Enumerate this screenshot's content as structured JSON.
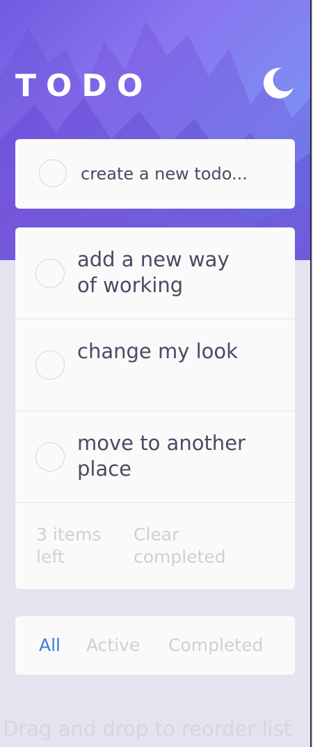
{
  "header": {
    "title": "TODO",
    "theme_toggle_icon": "moon-icon"
  },
  "new_todo": {
    "placeholder": "create a new todo..."
  },
  "todos": [
    {
      "text": "add a new way of working",
      "completed": false
    },
    {
      "text": "change my look",
      "completed": false
    },
    {
      "text": "move to another place",
      "completed": false
    }
  ],
  "footer": {
    "items_left": "3 items left",
    "clear_label": "Clear completed"
  },
  "filters": {
    "all": "All",
    "active": "Active",
    "completed": "Completed",
    "selected": "All"
  },
  "hint": "Drag and drop to reorder list",
  "colors": {
    "accent": "#3a7bd5",
    "text": "#4a4a63",
    "muted": "#cfcfd8",
    "card": "#fafafa",
    "page_bg": "#e4e4f0"
  }
}
